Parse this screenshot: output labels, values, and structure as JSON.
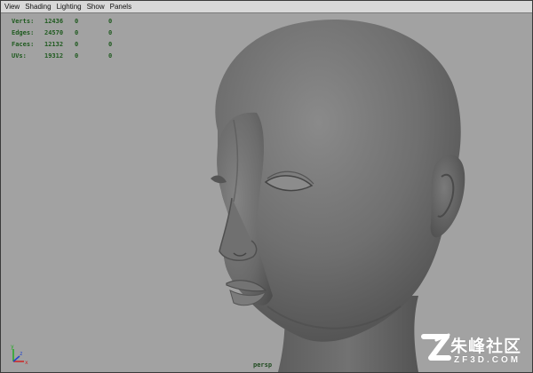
{
  "menubar": {
    "items": [
      {
        "label": "View"
      },
      {
        "label": "Shading"
      },
      {
        "label": "Lighting"
      },
      {
        "label": "Show"
      },
      {
        "label": "Panels"
      }
    ]
  },
  "hud": {
    "rows": [
      {
        "label": "Verts:",
        "value": "12436",
        "selected": "0",
        "last": "0"
      },
      {
        "label": "Edges:",
        "value": "24570",
        "selected": "0",
        "last": "0"
      },
      {
        "label": "Faces:",
        "value": "12132",
        "selected": "0",
        "last": "0"
      },
      {
        "label": "UVs:",
        "value": "19312",
        "selected": "0",
        "last": "0"
      }
    ]
  },
  "viewport": {
    "camera_label": "persp",
    "background": "#a2a2a2",
    "model_color": "#6e6e6e"
  },
  "axis": {
    "x_label": "x",
    "y_label": "y",
    "z_label": "z",
    "x_color": "#cc2222",
    "y_color": "#22aa22",
    "z_color": "#2244cc"
  },
  "watermark": {
    "chinese_text": "朱峰社区",
    "english_text": "ZF3D.COM"
  }
}
